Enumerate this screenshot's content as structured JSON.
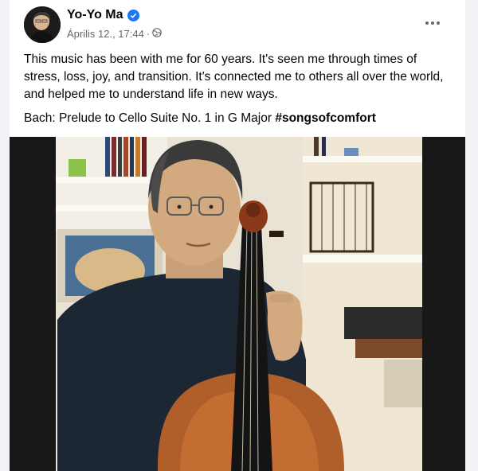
{
  "post": {
    "author": "Yo-Yo Ma",
    "timestamp": "Április 12., 17:44",
    "separator": "·",
    "privacy_icon": "globe-icon",
    "more_icon": "more-options-icon",
    "body_line": "This music has been with me for 60 years. It's seen me through times of stress, loss, joy, and transition. It's connected me to others all over the world, and helped me to understand life in new ways.",
    "piece": "Bach: Prelude to Cello Suite No. 1 in G Major",
    "hashtag": "#songsofcomfort"
  },
  "colors": {
    "verified": "#1877f2",
    "muted_text": "#65676b",
    "text": "#050505"
  }
}
